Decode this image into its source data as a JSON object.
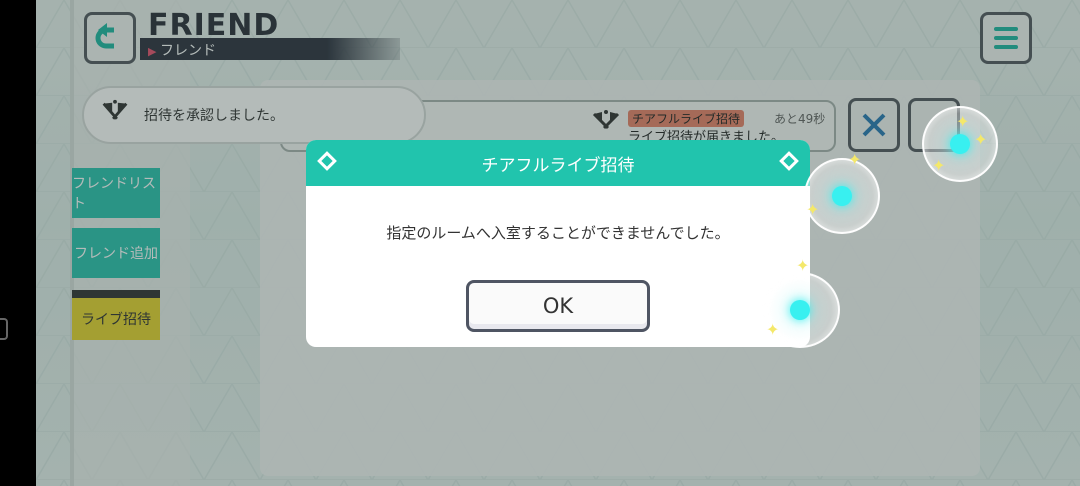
{
  "header": {
    "title_en": "FRIEND",
    "title_jp": "フレンド",
    "back_icon": "back-arrow-icon",
    "menu_icon": "hamburger-menu-icon"
  },
  "sidebar": {
    "items": [
      {
        "label": "フレンドリスト"
      },
      {
        "label": "フレンド追加"
      },
      {
        "label": "ライブ招待"
      }
    ]
  },
  "notification": {
    "text": "招待を承認しました。",
    "icon": "crossed-flags-icon"
  },
  "invitation": {
    "tag": "チアフルライブ招待",
    "timer": "あと49秒",
    "message": "ライブ招待が届きました。",
    "icon": "crossed-flags-icon"
  },
  "dialog": {
    "title": "チアフルライブ招待",
    "message": "指定のルームへ入室することができませんでした。",
    "ok_label": "OK"
  },
  "colors": {
    "teal": "#21c4ad",
    "yellow": "#e6d431",
    "dark": "#2e3240"
  }
}
